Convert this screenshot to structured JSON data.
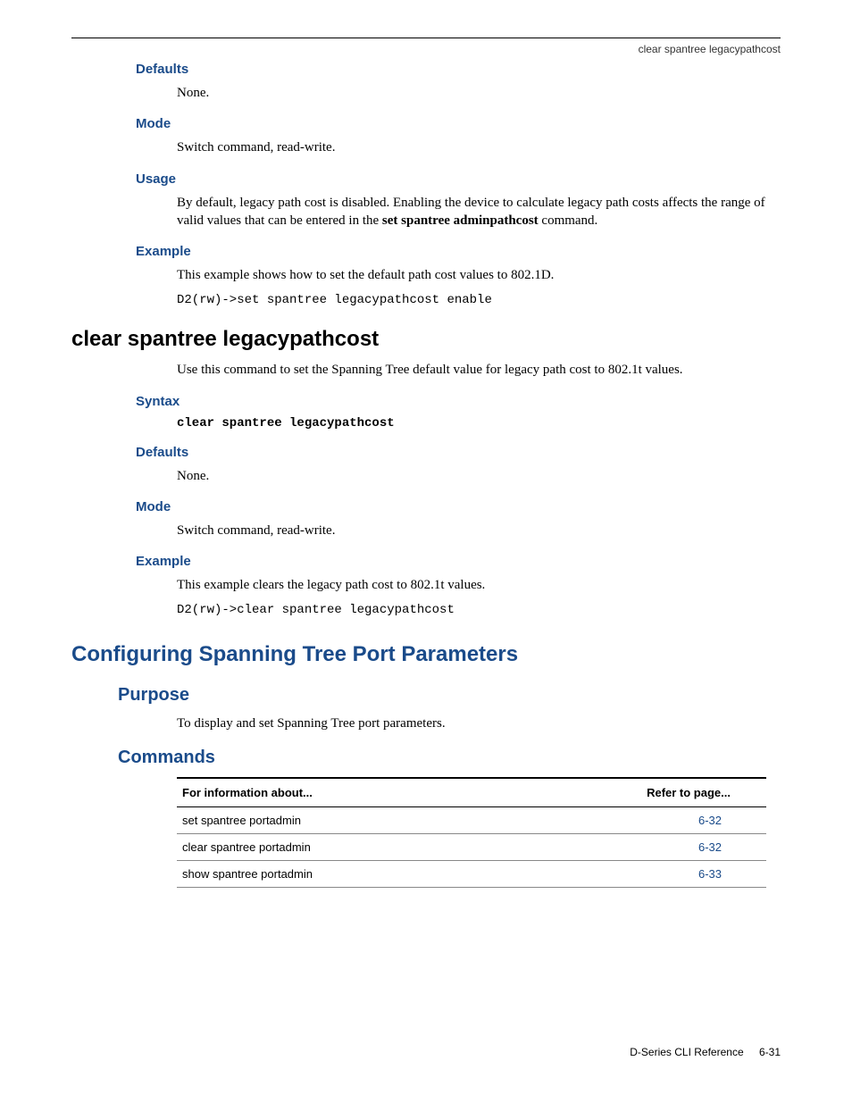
{
  "header": {
    "right": "clear spantree legacypathcost"
  },
  "s1": {
    "defaults_h": "Defaults",
    "defaults_t": "None.",
    "mode_h": "Mode",
    "mode_t": "Switch command, read-write.",
    "usage_h": "Usage",
    "usage_t1": "By default, legacy path cost is disabled. Enabling the device to calculate legacy path costs affects the range of valid values that can be entered in the ",
    "usage_bold": "set spantree adminpathcost",
    "usage_t2": " command.",
    "example_h": "Example",
    "example_t": "This example shows how to set the default path cost values to 802.1D.",
    "example_code": "D2(rw)->set spantree legacypathcost enable"
  },
  "s2": {
    "title": "clear spantree legacypathcost",
    "intro": "Use this command to set the Spanning Tree default value for legacy path cost to 802.1t values.",
    "syntax_h": "Syntax",
    "syntax_code": "clear spantree legacypathcost",
    "defaults_h": "Defaults",
    "defaults_t": "None.",
    "mode_h": "Mode",
    "mode_t": "Switch command, read-write.",
    "example_h": "Example",
    "example_t": "This example clears the legacy path cost to 802.1t values.",
    "example_code": "D2(rw)->clear spantree legacypathcost"
  },
  "s3": {
    "title": "Configuring Spanning Tree Port Parameters",
    "purpose_h": "Purpose",
    "purpose_t": "To display and set Spanning Tree port parameters.",
    "commands_h": "Commands",
    "table": {
      "h1": "For information about...",
      "h2": "Refer to page...",
      "rows": [
        {
          "cmd": "set spantree portadmin",
          "page": "6-32"
        },
        {
          "cmd": "clear spantree portadmin",
          "page": "6-32"
        },
        {
          "cmd": "show spantree portadmin",
          "page": "6-33"
        }
      ]
    }
  },
  "footer": {
    "doc": "D-Series CLI Reference",
    "page": "6-31"
  }
}
